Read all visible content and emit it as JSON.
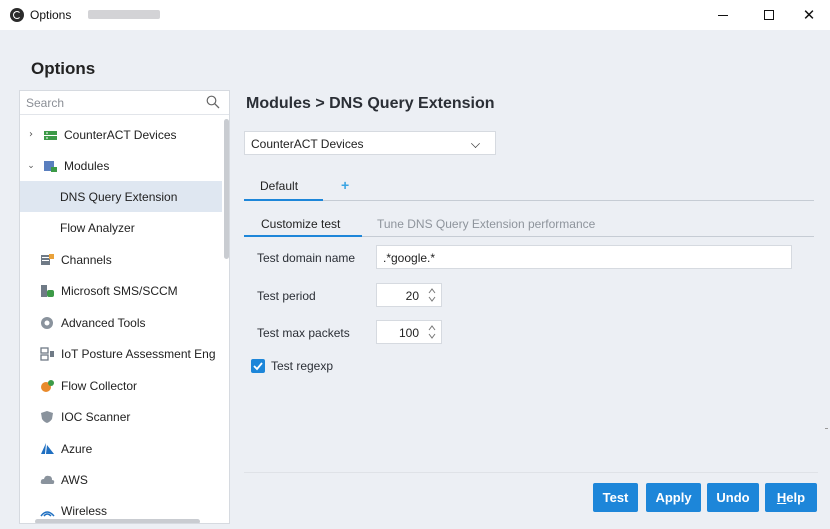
{
  "window": {
    "title": "Options",
    "controls": {
      "minimize": "minimize-icon",
      "maximize": "maximize-icon",
      "close": "✕"
    }
  },
  "header": {
    "title": "Options"
  },
  "sidebar": {
    "search_placeholder": "Search",
    "items": [
      {
        "label": "CounterACT Devices",
        "icon": "counteract-devices-icon",
        "expander": "›"
      },
      {
        "label": "Modules",
        "icon": "modules-icon",
        "expander": "⌄"
      },
      {
        "label": "DNS Query Extension",
        "selected": true
      },
      {
        "label": "Flow Analyzer"
      },
      {
        "label": "Channels",
        "icon": "channels-icon"
      },
      {
        "label": "Microsoft SMS/SCCM",
        "icon": "sccm-icon"
      },
      {
        "label": "Advanced Tools",
        "icon": "advanced-tools-icon"
      },
      {
        "label": "IoT Posture Assessment Eng",
        "icon": "iot-icon"
      },
      {
        "label": "Flow Collector",
        "icon": "flow-collector-icon"
      },
      {
        "label": "IOC Scanner",
        "icon": "ioc-scanner-icon"
      },
      {
        "label": "Azure",
        "icon": "azure-icon"
      },
      {
        "label": "AWS",
        "icon": "aws-icon"
      },
      {
        "label": "Wireless",
        "icon": "wireless-icon"
      }
    ]
  },
  "main": {
    "title": "Modules > DNS Query Extension",
    "device_select": {
      "value": "CounterACT Devices"
    },
    "tabs": [
      {
        "label": "Default",
        "active": true
      }
    ],
    "add_tab": "+",
    "subtabs": [
      {
        "label": "Customize test",
        "active": true
      },
      {
        "label": "Tune DNS Query Extension performance",
        "active": false
      }
    ],
    "fields": {
      "test_domain_name": {
        "label": "Test domain name",
        "value": ".*google.*"
      },
      "test_period": {
        "label": "Test period",
        "value": "20"
      },
      "test_max_packets": {
        "label": "Test max packets",
        "value": "100"
      },
      "test_regexp": {
        "label": "Test regexp",
        "checked": true
      }
    }
  },
  "buttons": {
    "test": "Test",
    "apply": "Apply",
    "undo": "Undo",
    "help_first": "H",
    "help_rest": "elp"
  },
  "colors": {
    "accent": "#1d86d9",
    "background": "#eceff4",
    "selected_row": "#dfe7f1"
  }
}
